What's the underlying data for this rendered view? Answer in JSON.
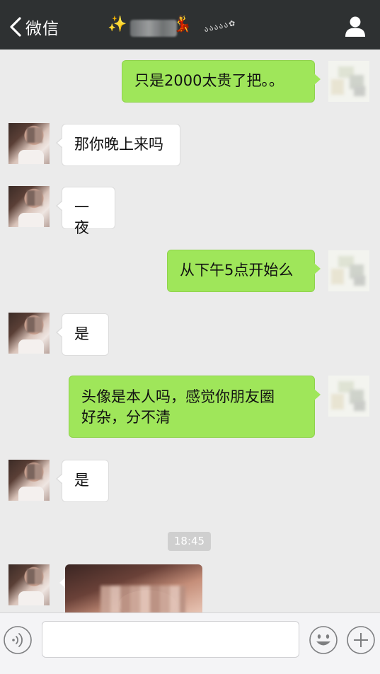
{
  "navbar": {
    "back_label": "微信",
    "title_prefix_emoji": "✨",
    "title_suffix_emoji": "💃",
    "title_decoration": "ა ა ა ა ა ✿"
  },
  "messages": [
    {
      "from": "me",
      "text": "只是2000太贵了把。。"
    },
    {
      "from": "them",
      "text": "那你晚上来吗"
    },
    {
      "from": "them",
      "text": "一夜"
    },
    {
      "from": "me",
      "text": "从下午5点开始么"
    },
    {
      "from": "them",
      "text": "是"
    },
    {
      "from": "me",
      "text": "头像是本人吗，感觉你朋友圈\n好杂，分不清"
    },
    {
      "from": "them",
      "text": "是"
    }
  ],
  "timestamp": "18:45",
  "input": {
    "value": "",
    "placeholder": ""
  },
  "colors": {
    "navbar_bg": "#2e3132",
    "chat_bg": "#ebebeb",
    "my_bubble": "#9fe65a",
    "their_bubble": "#ffffff"
  },
  "icons": {
    "back": "chevron-left-icon",
    "profile": "person-icon",
    "voice": "voice-icon",
    "emoji": "emoji-icon",
    "plus": "plus-icon"
  }
}
